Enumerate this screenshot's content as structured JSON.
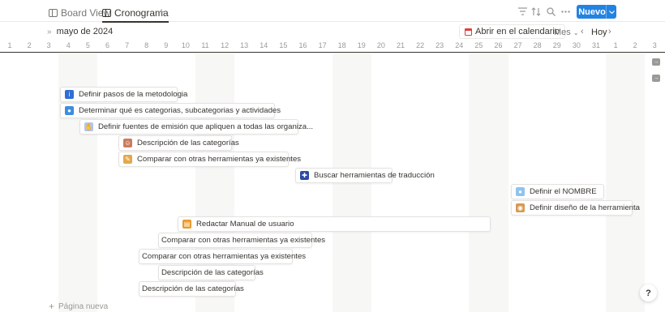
{
  "toolbar": {
    "tabs": [
      {
        "label": "Board View"
      },
      {
        "label": "Cronograma"
      }
    ],
    "new_label": "Nuevo"
  },
  "timeline": {
    "month": "mayo de 2024",
    "open_calendar": "Abrir en el calendario",
    "scale": "Mes",
    "today": "Hoy",
    "days": [
      "1",
      "2",
      "3",
      "4",
      "5",
      "6",
      "7",
      "8",
      "9",
      "10",
      "11",
      "12",
      "13",
      "14",
      "15",
      "16",
      "17",
      "18",
      "19",
      "20",
      "21",
      "22",
      "23",
      "24",
      "25",
      "26",
      "27",
      "28",
      "29",
      "30",
      "31",
      "1",
      "2",
      "3"
    ]
  },
  "tasks": [
    {
      "label": "Definir pasos de la metodologia",
      "icon": "info-icon",
      "color": "#2f6fd6"
    },
    {
      "label": "Determinar qué es categorias, subcategorias y actividades",
      "icon": "speech-bubble-icon",
      "color": "#3d8de0"
    },
    {
      "label": "Definir fuentes de emisión que apliquen a todas las organiza...",
      "icon": "hand-icon",
      "color": "#b8c3e6"
    },
    {
      "label": "Descripción de las categorías",
      "icon": "person-icon",
      "color": "#c97c5d"
    },
    {
      "label": "Comparar con otras herramientas ya existentes",
      "icon": "pencil-icon",
      "color": "#e3a84a"
    },
    {
      "label": "Buscar herramientas de traducción",
      "icon": "flag-icon",
      "color": "#2d4aa6"
    },
    {
      "label": "Definir el NOMBRE",
      "icon": "speech-bubble-icon",
      "color": "#8ec3f0"
    },
    {
      "label": "Definir diseño de la herramienta",
      "icon": "palette-icon",
      "color": "#d69a52"
    },
    {
      "label": "Redactar Manual de usuario",
      "icon": "notebook-icon",
      "color": "#e89a2c"
    },
    {
      "label": "Comparar con otras herramientas ya existentes",
      "icon": "",
      "color": ""
    },
    {
      "label": "Comparar con otras herramientas ya existentes",
      "icon": "",
      "color": ""
    },
    {
      "label": "Descripción de las categorías",
      "icon": "",
      "color": ""
    },
    {
      "label": "Descripción de las categorías",
      "icon": "",
      "color": ""
    }
  ],
  "footer": {
    "new_page": "Página nueva",
    "help": "?"
  }
}
